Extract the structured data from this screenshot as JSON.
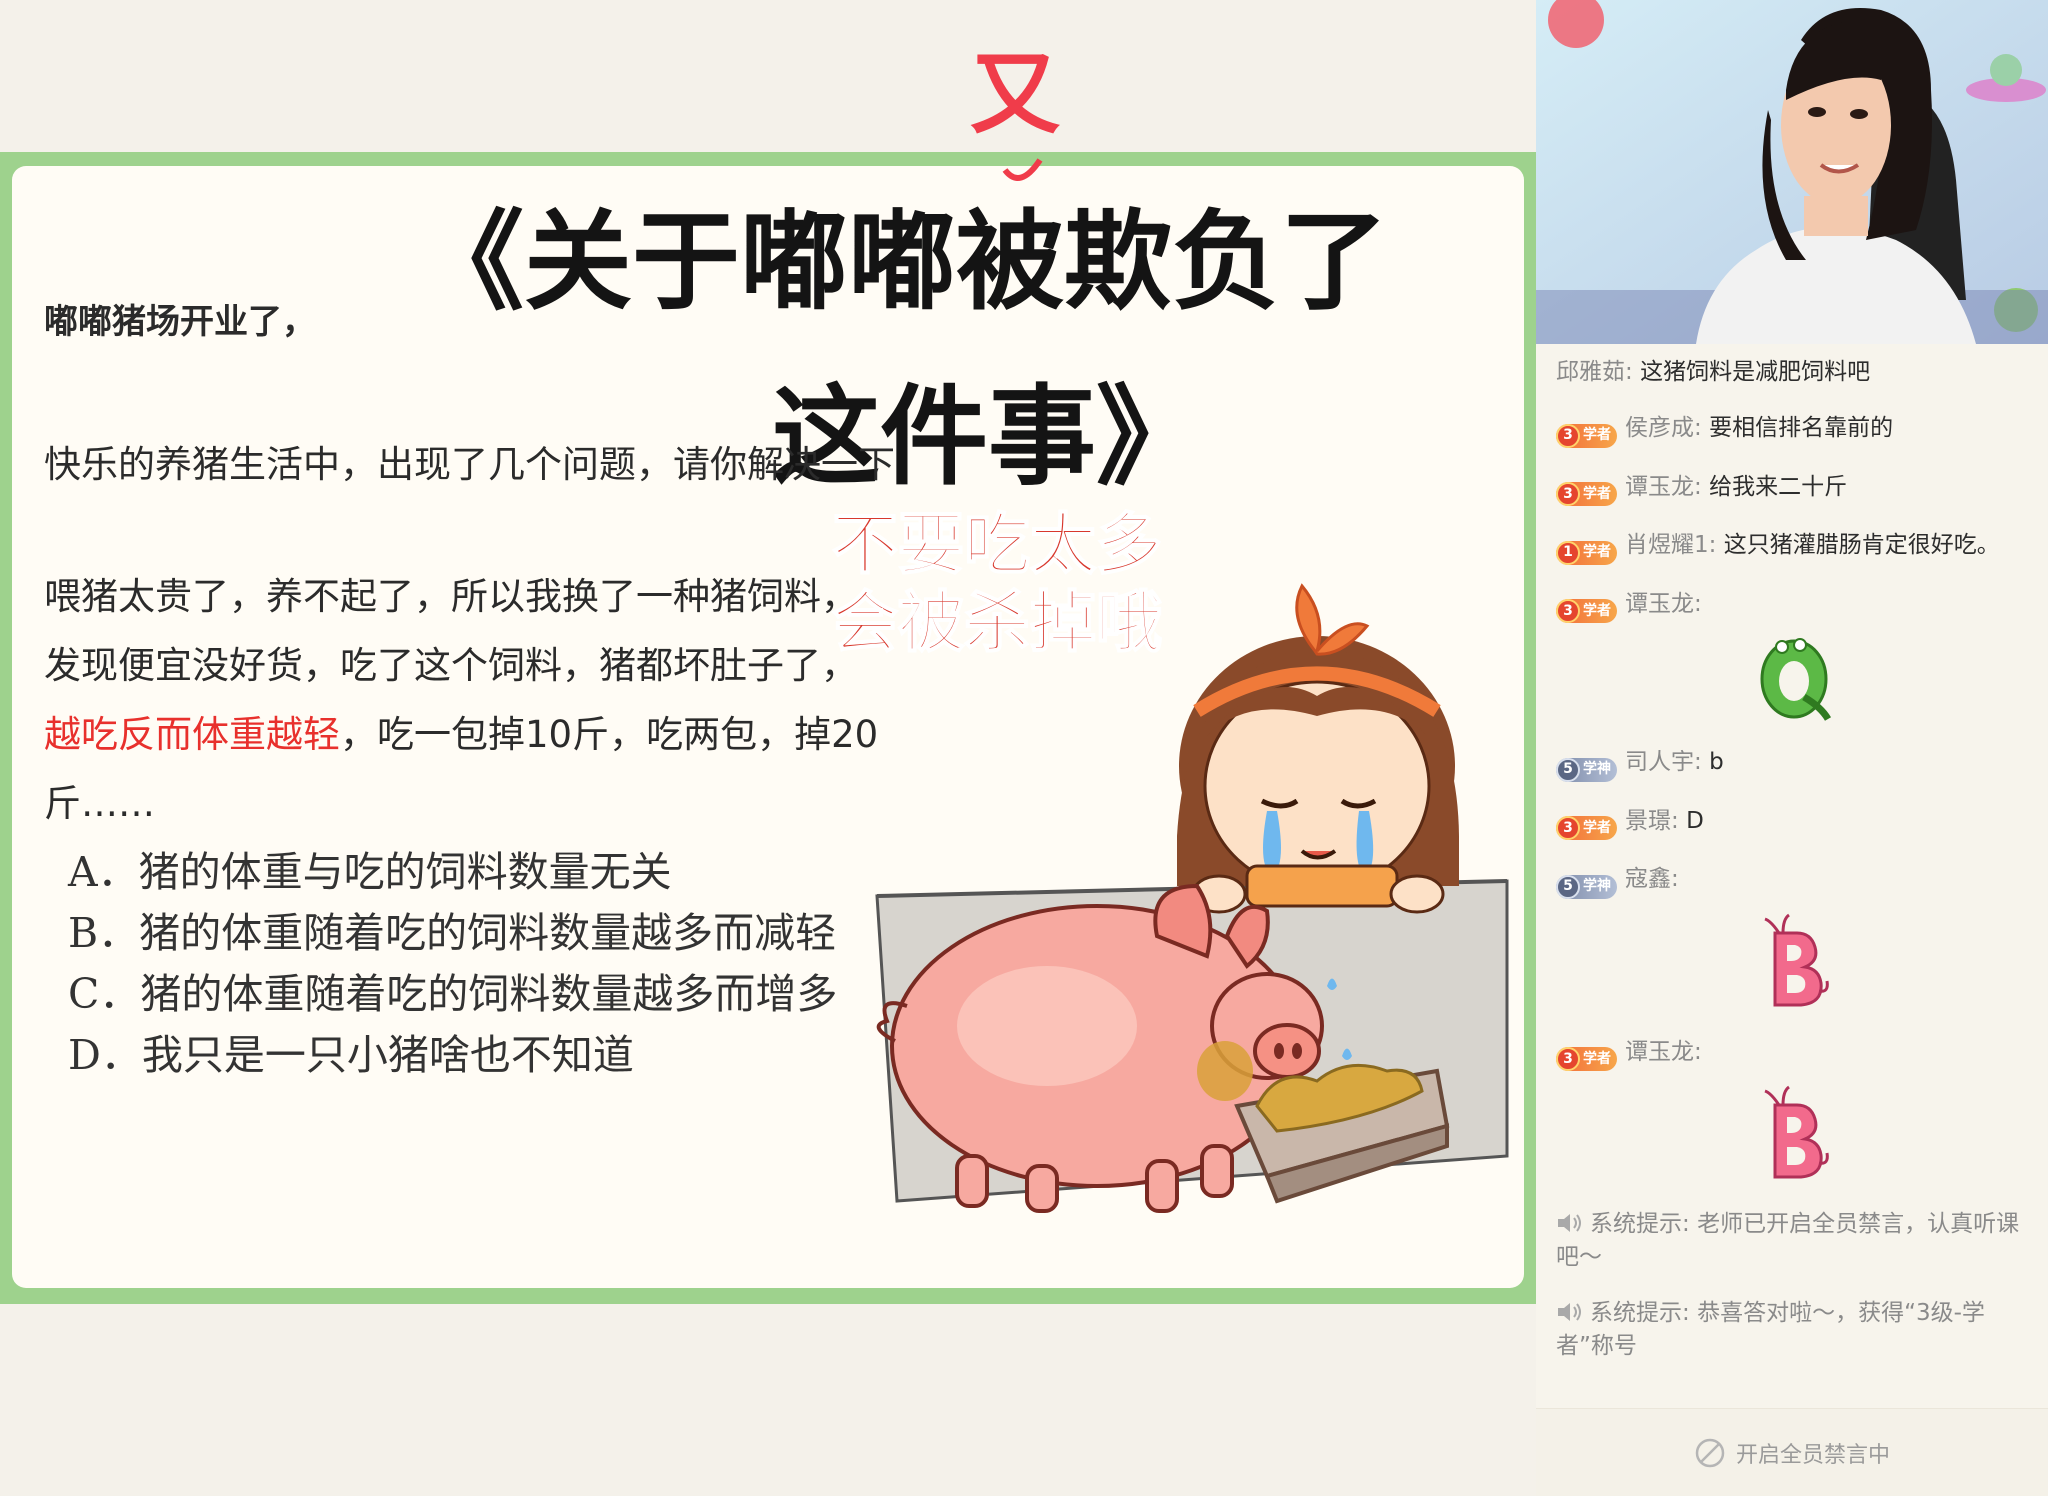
{
  "slide": {
    "opening": "嘟嘟猪场开业了，",
    "handwritten_title_line1": "《关于嘟嘟被欺负了",
    "handwritten_title_line2": "这件事》",
    "handwritten_correction": "又",
    "intro": "快乐的养猪生活中，出现了几个问题，请你解决一下",
    "story_part1": "喂猪太贵了，养不起了，所以我换了一种猪饲料，发现便宜没好货，吃了这个饲料，猪都坏肚子了，",
    "story_highlight": "越吃反而体重越轻",
    "story_part2": "，吃一包掉10斤，吃两包，掉20斤……",
    "warning_line1": "不要吃太多",
    "warning_line2": "会被杀掉哦",
    "options": [
      "A．猪的体重与吃的饲料数量无关",
      "B．猪的体重随着吃的饲料数量越多而减轻",
      "C．猪的体重随着吃的饲料数量越多而增多",
      "D．我只是一只小猪啥也不知道"
    ],
    "highlight_color": "#e8302c",
    "frame_color": "#9ed28d"
  },
  "chat": {
    "messages": [
      {
        "badge": "",
        "name": "邱雅茹",
        "text": "这猪饲料是减肥饲料吧"
      },
      {
        "badge": "学者",
        "level": "3",
        "name": "侯彦成",
        "text": "要相信排名靠前的"
      },
      {
        "badge": "学者",
        "level": "3",
        "name": "谭玉龙",
        "text": "给我来二十斤"
      },
      {
        "badge": "学者",
        "level": "1",
        "name": "肖煜耀1",
        "text": "这只猪灌腊肠肯定很好吃。"
      },
      {
        "badge": "学者",
        "level": "3",
        "name": "谭玉龙",
        "text": "",
        "sticker": "Q"
      },
      {
        "badge": "学神",
        "level": "5",
        "name": "司人宇",
        "text": "b"
      },
      {
        "badge": "学者",
        "level": "3",
        "name": "景璟",
        "text": "D"
      },
      {
        "badge": "学神",
        "level": "5",
        "name": "寇鑫",
        "text": "",
        "sticker": "B"
      },
      {
        "badge": "学者",
        "level": "3",
        "name": "谭玉龙",
        "text": "",
        "sticker": "B"
      }
    ],
    "system": [
      {
        "label": "系统提示",
        "text": "老师已开启全员禁言，认真听课吧～"
      },
      {
        "label": "系统提示",
        "text": "恭喜答对啦～，获得“3级-学者”称号"
      }
    ],
    "mute_status": "开启全员禁言中"
  }
}
